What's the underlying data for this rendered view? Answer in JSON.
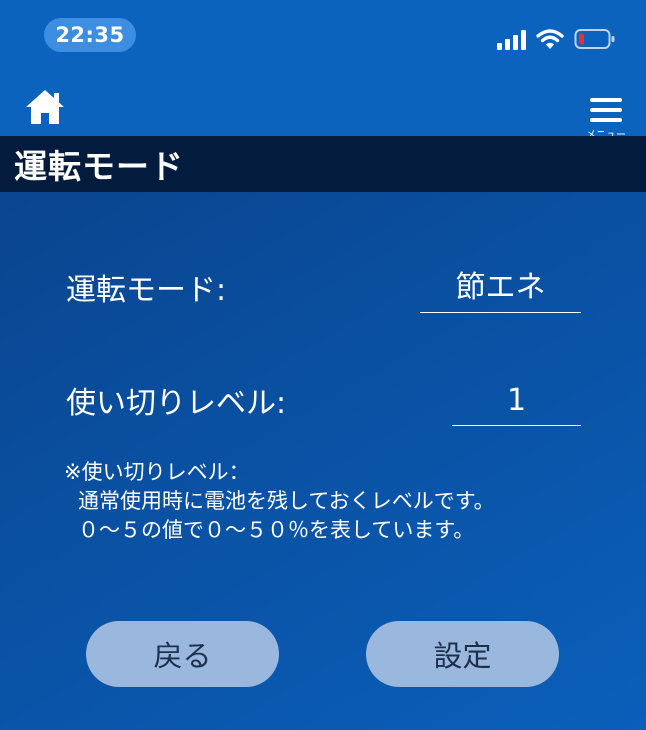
{
  "status_bar": {
    "time": "22:35",
    "icons": [
      "signal-icon",
      "wifi-icon",
      "battery-low-icon"
    ],
    "battery_color": "#e6322c"
  },
  "nav": {
    "home_icon": "home-icon",
    "menu_icon": "hamburger-menu-icon",
    "menu_label": "メニュー"
  },
  "page": {
    "title": "運転モード"
  },
  "form": {
    "mode_label": "運転モード:",
    "mode_value": "節エネ",
    "level_label": "使い切りレベル:",
    "level_value": "1"
  },
  "note": {
    "lines": [
      "※使い切りレベル：",
      "通常使用時に電池を残しておくレベルです。",
      "０～５の値で０～５０％を表しています。"
    ]
  },
  "buttons": {
    "back_label": "戻る",
    "set_label": "設定"
  },
  "colors": {
    "header_blue": "#0c63be",
    "title_bar": "#031c3d",
    "button_bg": "#9ab7dd",
    "button_text": "#1d2f4d"
  }
}
